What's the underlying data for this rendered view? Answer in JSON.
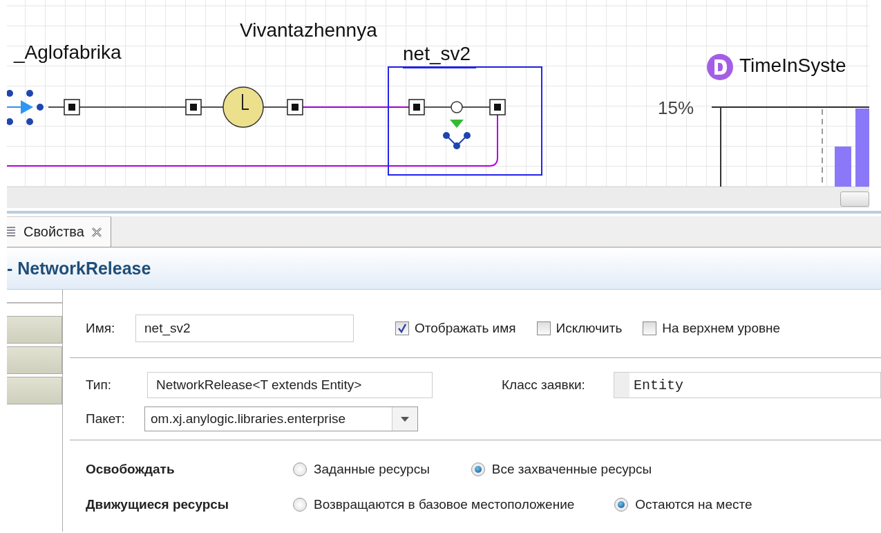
{
  "diagram": {
    "blocks": [
      {
        "kind": "source",
        "label": "_Aglofabrika",
        "selected": false
      },
      {
        "kind": "delay",
        "label": "Vivantazhennya",
        "selected": false
      },
      {
        "kind": "release",
        "label": "net_sv2",
        "selected": true
      }
    ],
    "histogram": {
      "title": "TimeInSyste",
      "tick_label": "15%"
    }
  },
  "tabs": [
    {
      "label": "Свойства",
      "selected": true
    }
  ],
  "properties": {
    "header": "- NetworkRelease",
    "name": {
      "label": "Имя:",
      "value": "net_sv2"
    },
    "checkboxes": [
      {
        "label": "Отображать имя",
        "checked": true
      },
      {
        "label": "Исключить",
        "checked": false
      },
      {
        "label": "На верхнем уровне",
        "checked": false
      }
    ],
    "type": {
      "label": "Тип:",
      "value": "NetworkRelease<T extends Entity>"
    },
    "agent_class": {
      "label": "Класс заявки:",
      "value": "Entity"
    },
    "package": {
      "label": "Пакет:",
      "value": "om.xj.anylogic.libraries.enterprise"
    },
    "radio_groups": [
      {
        "label": "Освобождать",
        "options": [
          {
            "label": "Заданные ресурсы",
            "selected": false
          },
          {
            "label": "Все захваченные ресурсы",
            "selected": true
          }
        ]
      },
      {
        "label": "Движущиеся ресурсы",
        "options": [
          {
            "label": "Возвращаются в базовое местоположение",
            "selected": false
          },
          {
            "label": "Остаются на месте",
            "selected": true
          }
        ]
      }
    ]
  }
}
